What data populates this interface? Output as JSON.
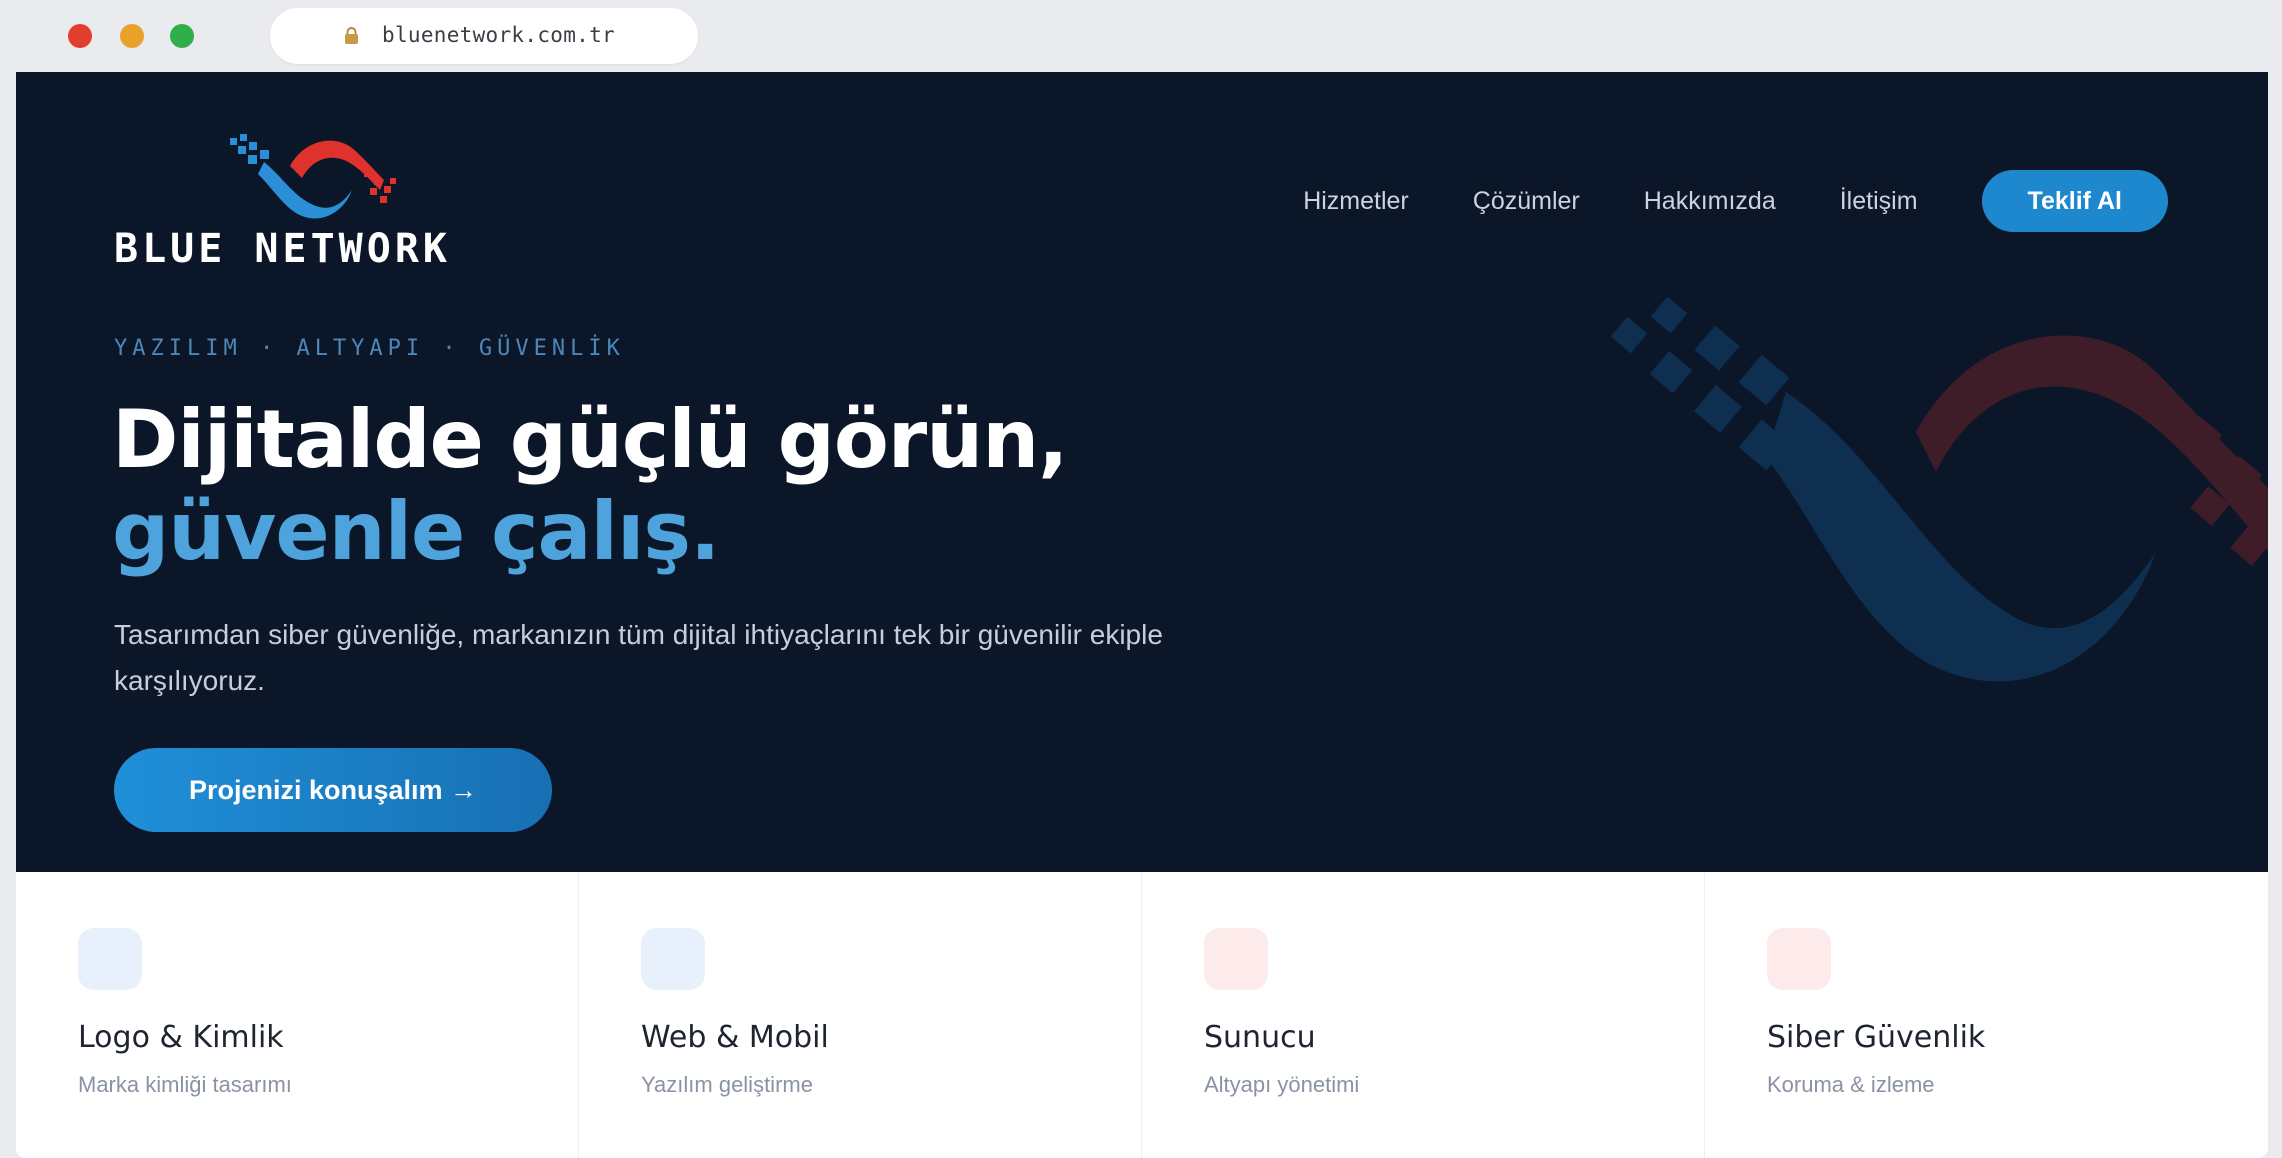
{
  "browser": {
    "url": "bluenetwork.com.tr"
  },
  "brand": {
    "name": "BLUE NETWORK"
  },
  "nav": {
    "items": [
      {
        "label": "Hizmetler"
      },
      {
        "label": "Çözümler"
      },
      {
        "label": "Hakkımızda"
      },
      {
        "label": "İletişim"
      }
    ],
    "cta_label": "Teklif Al"
  },
  "hero": {
    "eyebrow": "YAZILIM · ALTYAPI · GÜVENLİK",
    "headline_line1": "Dijitalde güçlü görün,",
    "headline_line2": "güvenle çalış.",
    "lead": "Tasarımdan siber güvenliğe, markanızın tüm dijital ihtiyaçlarını tek bir güvenilir ekiple karşılıyoruz.",
    "cta_label": "Projenizi konuşalım →"
  },
  "services": [
    {
      "title": "Logo & Kimlik",
      "subtitle": "Marka kimliği tasarımı",
      "icon_color": "#e8f1fb"
    },
    {
      "title": "Web & Mobil",
      "subtitle": "Yazılım geliştirme",
      "icon_color": "#e8f1fb"
    },
    {
      "title": "Sunucu",
      "subtitle": "Altyapı yönetimi",
      "icon_color": "#fcebea"
    },
    {
      "title": "Siber Güvenlik",
      "subtitle": "Koruma & izleme",
      "icon_color": "#fcebea"
    }
  ],
  "colors": {
    "hero_bg": "#0b1628",
    "accent_blue": "#1e88cf",
    "headline_blue": "#4ea3dc",
    "brand_red": "#e0322c"
  }
}
